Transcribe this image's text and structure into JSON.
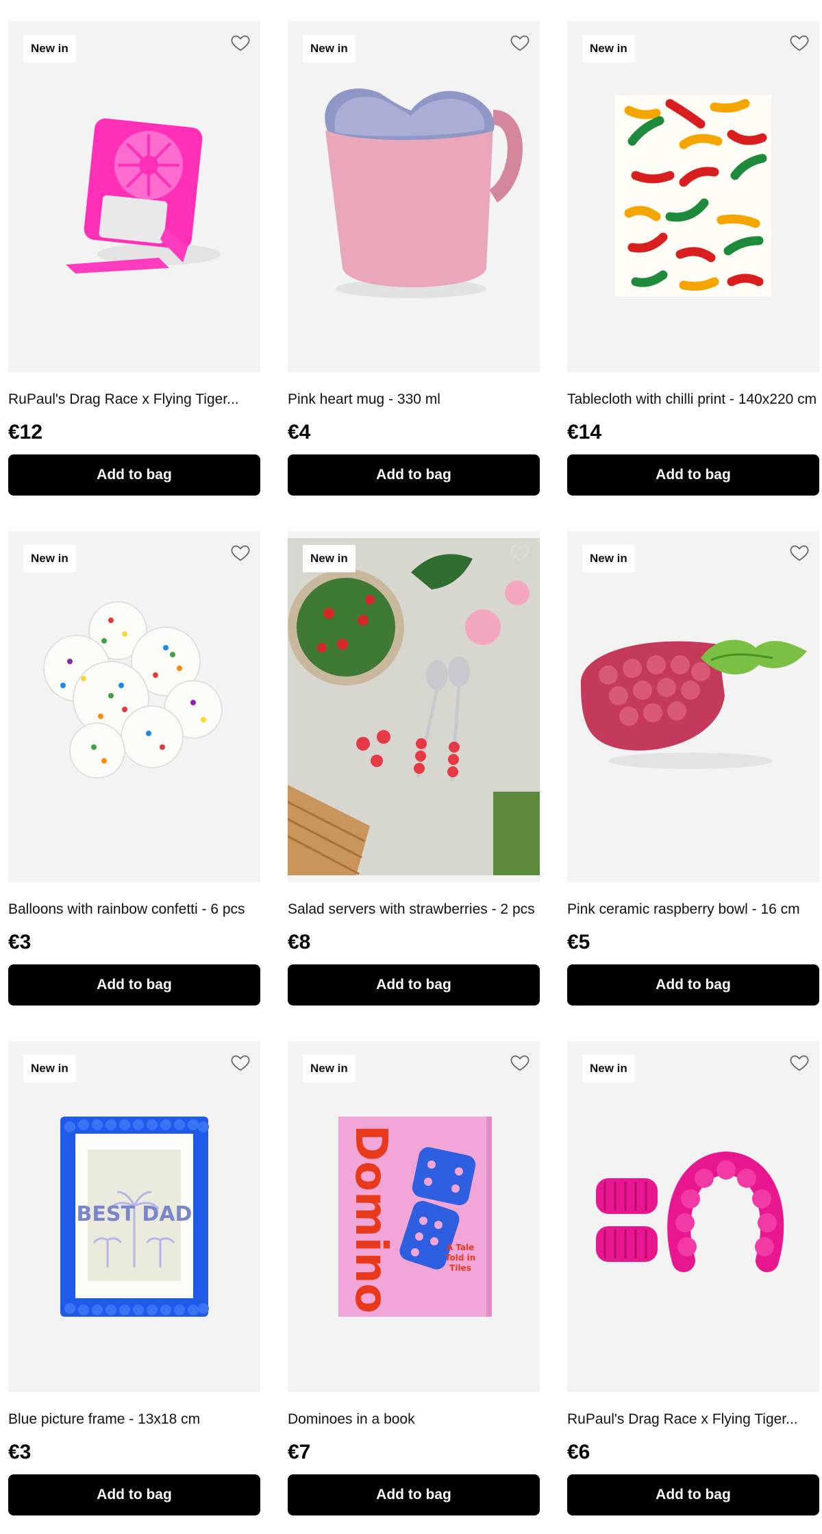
{
  "products": [
    {
      "badge": "New in",
      "title": "RuPaul's Drag Race x Flying Tiger...",
      "price": "€12",
      "button": "Add to bag",
      "image": "pink-mirror-fan"
    },
    {
      "badge": "New in",
      "title": "Pink heart mug - 330 ml",
      "price": "€4",
      "button": "Add to bag",
      "image": "pink-heart-mug"
    },
    {
      "badge": "New in",
      "title": "Tablecloth with chilli print - 140x220 cm",
      "price": "€14",
      "button": "Add to bag",
      "image": "chilli-tablecloth"
    },
    {
      "badge": "New in",
      "title": "Balloons with rainbow confetti - 6 pcs",
      "price": "€3",
      "button": "Add to bag",
      "image": "confetti-balloons"
    },
    {
      "badge": "New in",
      "title": "Salad servers with strawberries - 2 pcs",
      "price": "€8",
      "button": "Add to bag",
      "image": "salad-picnic"
    },
    {
      "badge": "New in",
      "title": "Pink ceramic raspberry bowl - 16 cm",
      "price": "€5",
      "button": "Add to bag",
      "image": "raspberry-bowl"
    },
    {
      "badge": "New in",
      "title": "Blue picture frame - 13x18 cm",
      "price": "€3",
      "button": "Add to bag",
      "image": "blue-frame",
      "frame_text": "BEST DAD"
    },
    {
      "badge": "New in",
      "title": "Dominoes in a book",
      "price": "€7",
      "button": "Add to bag",
      "image": "domino-book",
      "book_title": "Domino",
      "book_subtitle": "A Tale Told in Tiles"
    },
    {
      "badge": "New in",
      "title": "RuPaul's Drag Race x Flying Tiger...",
      "price": "€6",
      "button": "Add to bag",
      "image": "pink-scrunchies-headband"
    }
  ]
}
